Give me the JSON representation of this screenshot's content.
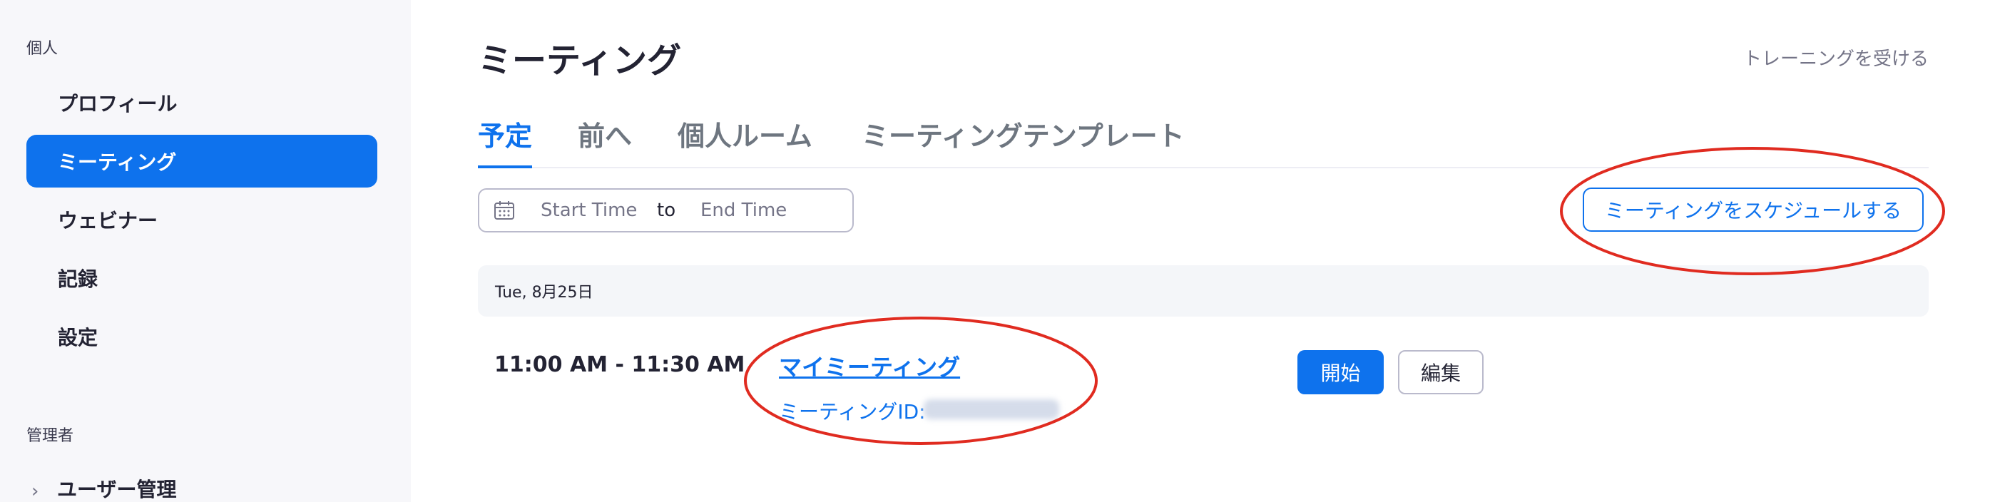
{
  "sidebar": {
    "personal_label": "個人",
    "items": [
      {
        "label": "プロフィール"
      },
      {
        "label": "ミーティング"
      },
      {
        "label": "ウェビナー"
      },
      {
        "label": "記録"
      },
      {
        "label": "設定"
      }
    ],
    "admin_label": "管理者",
    "admin_items": [
      {
        "label": "ユーザー管理"
      }
    ]
  },
  "header": {
    "title": "ミーティング",
    "training_link": "トレーニングを受ける"
  },
  "tabs": [
    {
      "label": "予定"
    },
    {
      "label": "前へ"
    },
    {
      "label": "個人ルーム"
    },
    {
      "label": "ミーティングテンプレート"
    }
  ],
  "date_filter": {
    "start_placeholder": "Start Time",
    "to_label": "to",
    "end_placeholder": "End Time"
  },
  "schedule_button": "ミーティングをスケジュールする",
  "meetings": {
    "date_header": "Tue, 8月25日",
    "rows": [
      {
        "time": "11:00 AM - 11:30 AM",
        "title": "マイミーティング",
        "id_label": "ミーティングID:",
        "start_label": "開始",
        "edit_label": "編集"
      }
    ]
  },
  "colors": {
    "accent": "#0e72ed",
    "annotation": "#e02b20",
    "sidebar_bg": "#f7f7fa"
  }
}
